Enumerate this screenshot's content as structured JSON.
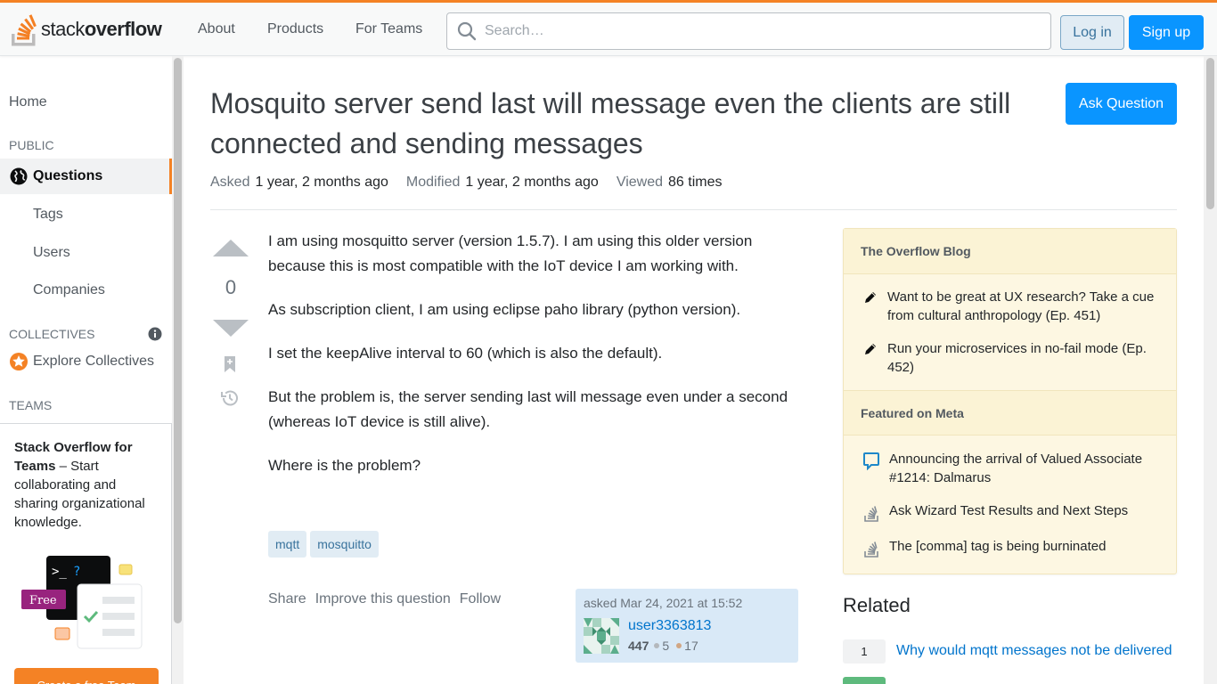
{
  "header": {
    "logo_part1": "stack",
    "logo_part2": "overflow",
    "nav": [
      "About",
      "Products",
      "For Teams"
    ],
    "search_placeholder": "Search…",
    "login": "Log in",
    "signup": "Sign up",
    "accent_color": "#f48225",
    "primary_color": "#0a95ff"
  },
  "leftnav": {
    "home": "Home",
    "public_label": "PUBLIC",
    "questions": "Questions",
    "tags": "Tags",
    "users": "Users",
    "companies": "Companies",
    "collectives_label": "COLLECTIVES",
    "explore_collectives": "Explore Collectives",
    "teams_label": "TEAMS",
    "teams_title": "Stack Overflow for Teams",
    "teams_desc": " – Start collaborating and sharing organizational knowledge.",
    "teams_free": "Free",
    "teams_cta": "Create a free Team"
  },
  "question": {
    "title": "Mosquito server send last will message even the clients are still connected and sending messages",
    "ask_button": "Ask Question",
    "asked_label": "Asked",
    "asked_value": "1 year, 2 months ago",
    "modified_label": "Modified",
    "modified_value": "1 year, 2 months ago",
    "viewed_label": "Viewed",
    "viewed_value": "86 times",
    "votes": "0",
    "body": [
      "I am using mosquitto server (version 1.5.7). I am using this older version because this is most compatible with the IoT device I am working with.",
      "As subscription client, I am using eclipse paho library (python version).",
      "I set the keepAlive interval to 60 (which is also the default).",
      "But the problem is, the server sending last will message even under a second (whereas IoT device is still alive).",
      "Where is the problem?"
    ],
    "tags": [
      "mqtt",
      "mosquitto"
    ],
    "actions": [
      "Share",
      "Improve this question",
      "Follow"
    ],
    "asked_time": "asked Mar 24, 2021 at 15:52",
    "user_name": "user3363813",
    "user_rep": "447",
    "silver": "5",
    "bronze": "17"
  },
  "sidebar": {
    "blog_title": "The Overflow Blog",
    "blog_items": [
      "Want to be great at UX research? Take a cue from cultural anthropology (Ep. 451)",
      "Run your microservices in no-fail mode (Ep. 452)"
    ],
    "meta_title": "Featured on Meta",
    "meta_items": [
      "Announcing the arrival of Valued Associate #1214: Dalmarus",
      "Ask Wizard Test Results and Next Steps",
      "The [comma] tag is being burninated"
    ],
    "related_title": "Related",
    "related": [
      {
        "count": "1",
        "title": "Why would mqtt messages not be delivered"
      },
      {
        "count": "",
        "title": ""
      }
    ]
  }
}
